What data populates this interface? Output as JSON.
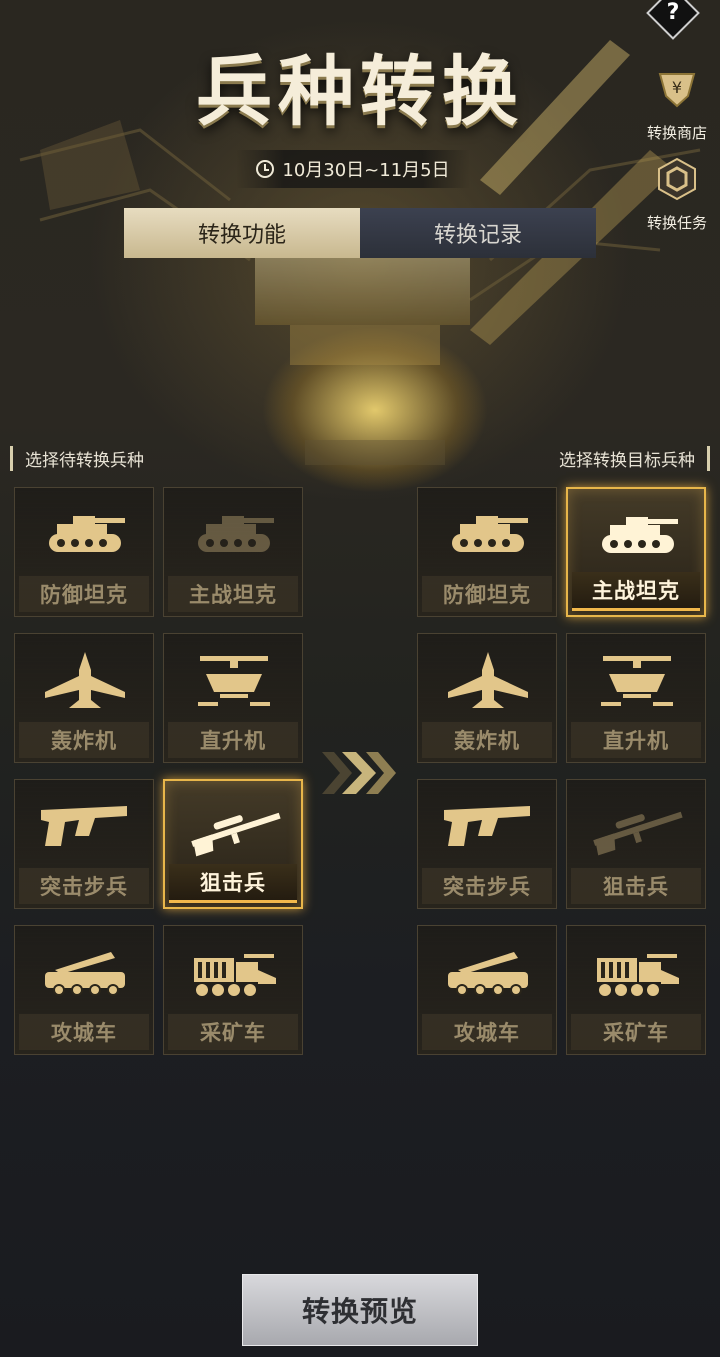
{
  "header": {
    "title": "兵种转换",
    "date_range": "10月30日~11月5日"
  },
  "top_right": {
    "help_symbol": "?",
    "shop_label": "转换商店",
    "task_label": "转换任务"
  },
  "tabs": {
    "active": "转换功能",
    "inactive": "转换记录"
  },
  "sections": {
    "left_title": "选择待转换兵种",
    "right_title": "选择转换目标兵种"
  },
  "left_grid": [
    {
      "label": "防御坦克",
      "icon": "tank-icon",
      "state": "normal"
    },
    {
      "label": "主战坦克",
      "icon": "tank-icon",
      "state": "dim"
    },
    {
      "label": "轰炸机",
      "icon": "bomber-icon",
      "state": "normal"
    },
    {
      "label": "直升机",
      "icon": "helicopter-icon",
      "state": "normal"
    },
    {
      "label": "突击步兵",
      "icon": "rifle-icon",
      "state": "normal"
    },
    {
      "label": "狙击兵",
      "icon": "sniper-rifle-icon",
      "state": "selected"
    },
    {
      "label": "攻城车",
      "icon": "rocket-launcher-icon",
      "state": "normal"
    },
    {
      "label": "采矿车",
      "icon": "mining-truck-icon",
      "state": "normal"
    }
  ],
  "right_grid": [
    {
      "label": "防御坦克",
      "icon": "tank-icon",
      "state": "normal"
    },
    {
      "label": "主战坦克",
      "icon": "tank-icon",
      "state": "selected"
    },
    {
      "label": "轰炸机",
      "icon": "bomber-icon",
      "state": "normal"
    },
    {
      "label": "直升机",
      "icon": "helicopter-icon",
      "state": "normal"
    },
    {
      "label": "突击步兵",
      "icon": "rifle-icon",
      "state": "normal"
    },
    {
      "label": "狙击兵",
      "icon": "sniper-rifle-icon",
      "state": "dim"
    },
    {
      "label": "攻城车",
      "icon": "rocket-launcher-icon",
      "state": "normal"
    },
    {
      "label": "采矿车",
      "icon": "mining-truck-icon",
      "state": "normal"
    }
  ],
  "footer": {
    "preview_button": "转换预览"
  },
  "colors": {
    "accent_gold": "#e8b64a",
    "icon_gold": "#e2c68a",
    "tab_active": "#e7dcc0",
    "tab_inactive": "#3c4150"
  }
}
